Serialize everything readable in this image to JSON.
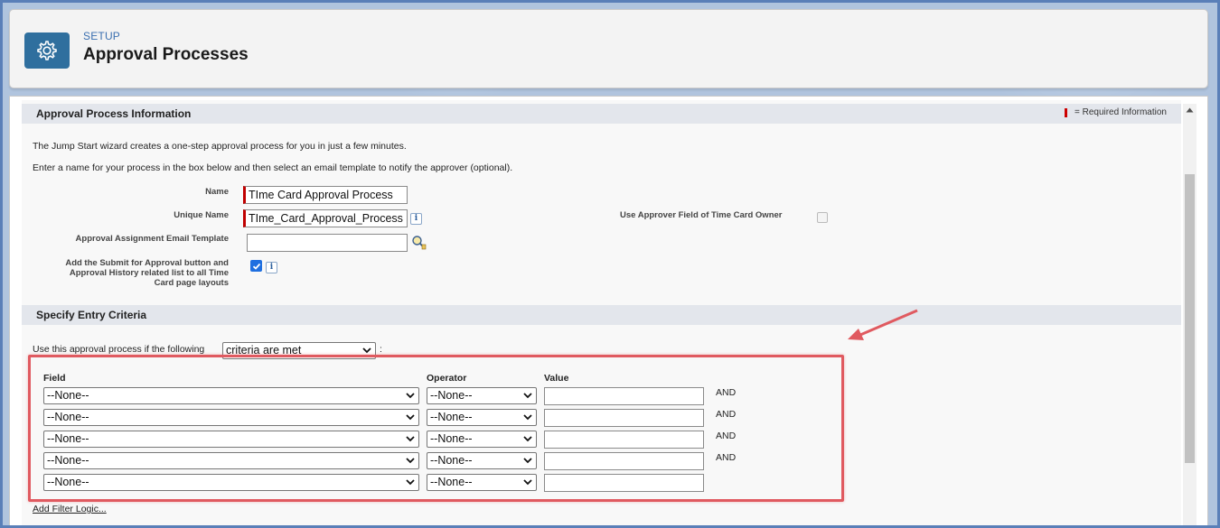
{
  "header": {
    "setup_label": "SETUP",
    "title": "Approval Processes",
    "icon": "gear-icon"
  },
  "section_info": {
    "title": "Approval Process Information",
    "required_legend": "= Required Information",
    "intro_1": "The Jump Start wizard creates a one-step approval process for you in just a few minutes.",
    "intro_2": "Enter a name for your process in the box below and then select an email template to notify the approver (optional).",
    "name_label": "Name",
    "name_value": "TIme Card Approval Process",
    "unique_name_label": "Unique Name",
    "unique_name_value": "TIme_Card_Approval_Process",
    "approver_field_label": "Use Approver Field of Time Card Owner",
    "approver_field_checked": false,
    "email_template_label": "Approval Assignment Email Template",
    "email_template_value": "",
    "submit_button_label_1": "Add the Submit for Approval button and",
    "submit_button_label_2": "Approval History related list to all Time",
    "submit_button_label_3": "Card page layouts",
    "submit_button_checked": true,
    "info_glyph": "i"
  },
  "section_criteria": {
    "title": "Specify Entry Criteria",
    "use_if_label": "Use this approval process if the following",
    "criteria_select": "criteria are met",
    "colon": ":",
    "headers": {
      "field": "Field",
      "operator": "Operator",
      "value": "Value"
    },
    "rows": [
      {
        "field": "--None--",
        "operator": "--None--",
        "value": "",
        "conj": "AND"
      },
      {
        "field": "--None--",
        "operator": "--None--",
        "value": "",
        "conj": "AND"
      },
      {
        "field": "--None--",
        "operator": "--None--",
        "value": "",
        "conj": "AND"
      },
      {
        "field": "--None--",
        "operator": "--None--",
        "value": "",
        "conj": "AND"
      },
      {
        "field": "--None--",
        "operator": "--None--",
        "value": "",
        "conj": ""
      }
    ],
    "filter_logic_link": "Add Filter Logic..."
  },
  "colors": {
    "accent": "#2f6f9e",
    "required": "#c00000",
    "annotation": "#e05a60"
  }
}
